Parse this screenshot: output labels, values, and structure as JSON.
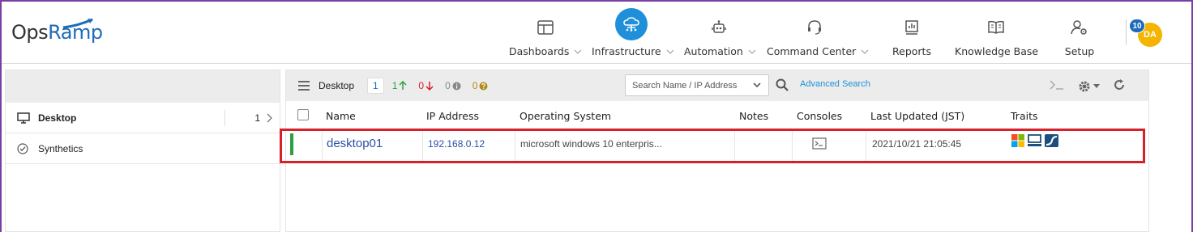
{
  "brand": {
    "name_part1": "Ops",
    "name_part2": "Ramp"
  },
  "nav": {
    "items": [
      {
        "label": "Dashboards",
        "icon": "dashboard-icon",
        "has_dropdown": true
      },
      {
        "label": "Infrastructure",
        "icon": "cloud-network-icon",
        "has_dropdown": true,
        "active": true
      },
      {
        "label": "Automation",
        "icon": "robot-icon",
        "has_dropdown": true
      },
      {
        "label": "Command Center",
        "icon": "headset-icon",
        "has_dropdown": true
      },
      {
        "label": "Reports",
        "icon": "report-icon",
        "has_dropdown": false
      },
      {
        "label": "Knowledge Base",
        "icon": "book-icon",
        "has_dropdown": false
      },
      {
        "label": "Setup",
        "icon": "user-gear-icon",
        "has_dropdown": false
      }
    ],
    "notification_count": "10",
    "user_initials": "DA"
  },
  "sidebar": {
    "items": [
      {
        "label": "Desktop",
        "count": "1",
        "icon": "monitor-icon",
        "selected": true
      },
      {
        "label": "Synthetics",
        "icon": "check-circle-icon",
        "selected": false
      }
    ]
  },
  "toolbar": {
    "title": "Desktop",
    "counts": {
      "total": "1",
      "up": "1",
      "down": "0",
      "unknown": "0",
      "undefined": "0"
    },
    "search_placeholder": "Search Name / IP Address",
    "advanced_search": "Advanced Search"
  },
  "table": {
    "columns": [
      "Name",
      "IP Address",
      "Operating System",
      "Notes",
      "Consoles",
      "Last Updated (JST)",
      "Traits"
    ],
    "rows": [
      {
        "name": "desktop01",
        "ip": "192.168.0.12",
        "os": "microsoft windows 10 enterpris...",
        "notes": "",
        "last_updated": "2021/10/21 21:05:45",
        "status": "up"
      }
    ]
  },
  "colors": {
    "accent": "#1e8fd8",
    "status_up": "#2e9e3e",
    "highlight": "#d6202a",
    "avatar": "#f5b400"
  }
}
